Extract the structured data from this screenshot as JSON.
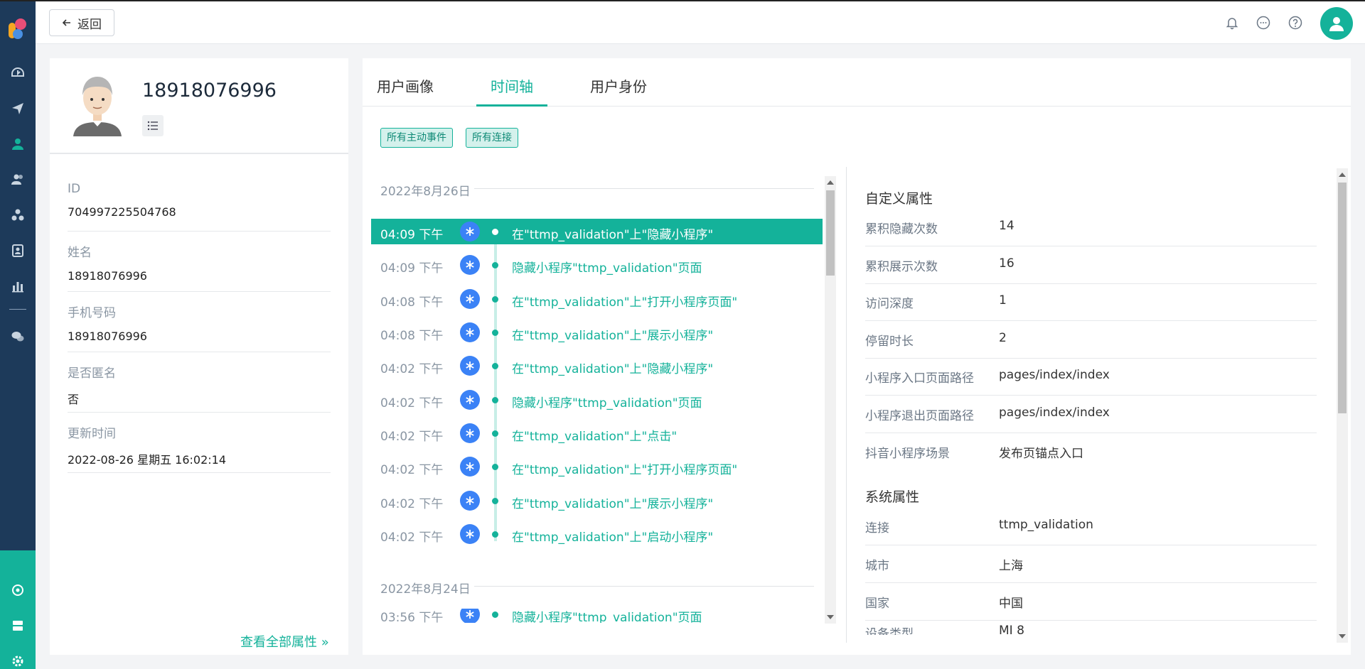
{
  "colors": {
    "accent": "#14b29a",
    "nav_bg": "#1d3a5a",
    "event_icon": "#3b82f6"
  },
  "nav": {
    "items": [
      "dashboard-icon",
      "send-icon",
      "user-icon",
      "users-icon",
      "cluster-icon",
      "badge-icon",
      "bar-chart-icon",
      "wechat-icon"
    ],
    "bottom": [
      "hub-icon",
      "server-icon",
      "gear-icon"
    ]
  },
  "header": {
    "back_label": "返回",
    "icons": [
      "bell-icon",
      "chat-icon",
      "help-icon",
      "avatar-icon"
    ]
  },
  "profile": {
    "name": "18918076996",
    "attributes": [
      {
        "label": "ID",
        "value": "704997225504768"
      },
      {
        "label": "姓名",
        "value": "18918076996"
      },
      {
        "label": "手机号码",
        "value": "18918076996"
      },
      {
        "label": "是否匿名",
        "value": "否"
      },
      {
        "label": "更新时间",
        "value": "2022-08-26 星期五 16:02:14"
      }
    ],
    "see_all": "查看全部属性 »"
  },
  "tabs": [
    {
      "label": "用户画像",
      "active": false
    },
    {
      "label": "时间轴",
      "active": true
    },
    {
      "label": "用户身份",
      "active": false
    }
  ],
  "filters": [
    "所有主动事件",
    "所有连接"
  ],
  "timeline": {
    "groups": [
      {
        "date": "2022年8月26日",
        "events": [
          {
            "time": "04:09 下午",
            "text": "在\"ttmp_validation\"上\"隐藏小程序\"",
            "selected": true
          },
          {
            "time": "04:09 下午",
            "text": "隐藏小程序\"ttmp_validation\"页面"
          },
          {
            "time": "04:08 下午",
            "text": "在\"ttmp_validation\"上\"打开小程序页面\""
          },
          {
            "time": "04:08 下午",
            "text": "在\"ttmp_validation\"上\"展示小程序\""
          },
          {
            "time": "04:02 下午",
            "text": "在\"ttmp_validation\"上\"隐藏小程序\""
          },
          {
            "time": "04:02 下午",
            "text": "隐藏小程序\"ttmp_validation\"页面"
          },
          {
            "time": "04:02 下午",
            "text": "在\"ttmp_validation\"上\"点击\""
          },
          {
            "time": "04:02 下午",
            "text": "在\"ttmp_validation\"上\"打开小程序页面\""
          },
          {
            "time": "04:02 下午",
            "text": "在\"ttmp_validation\"上\"展示小程序\""
          },
          {
            "time": "04:02 下午",
            "text": "在\"ttmp_validation\"上\"启动小程序\""
          }
        ]
      },
      {
        "date": "2022年8月24日",
        "events": [
          {
            "time": "03:56 下午",
            "text": "隐藏小程序\"ttmp_validation\"页面"
          }
        ]
      }
    ]
  },
  "properties": {
    "custom_title": "自定义属性",
    "custom": [
      {
        "key": "累积隐藏次数",
        "value": "14"
      },
      {
        "key": "累积展示次数",
        "value": "16"
      },
      {
        "key": "访问深度",
        "value": "1"
      },
      {
        "key": "停留时长",
        "value": "2"
      },
      {
        "key": "小程序入口页面路径",
        "value": "pages/index/index"
      },
      {
        "key": "小程序退出页面路径",
        "value": "pages/index/index"
      },
      {
        "key": "抖音小程序场景",
        "value": "发布页锚点入口"
      }
    ],
    "system_title": "系统属性",
    "system": [
      {
        "key": "连接",
        "value": "ttmp_validation"
      },
      {
        "key": "城市",
        "value": "上海"
      },
      {
        "key": "国家",
        "value": "中国"
      },
      {
        "key": "设备类型",
        "value": "MI 8"
      }
    ]
  }
}
